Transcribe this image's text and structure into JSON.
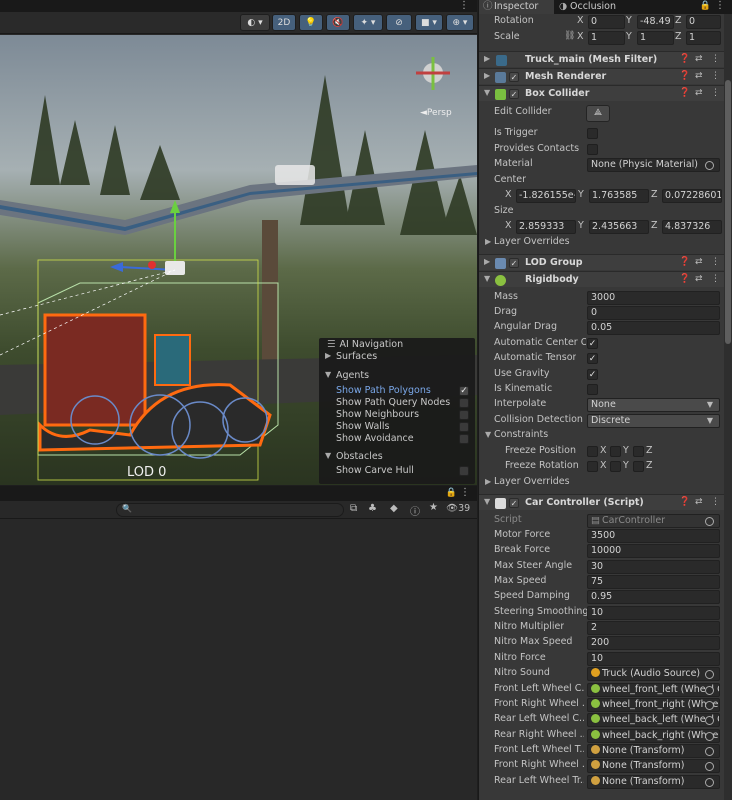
{
  "scene": {
    "toolbar": {
      "mode_2d": "2D"
    },
    "lod_label": "LOD 0",
    "persp_label": "◄Persp",
    "nav": {
      "title": "AI Navigation",
      "surfaces": "Surfaces",
      "agents": "Agents",
      "items": [
        {
          "label": "Show Path Polygons",
          "checked": true
        },
        {
          "label": "Show Path Query Nodes",
          "checked": false
        },
        {
          "label": "Show Neighbours",
          "checked": false
        },
        {
          "label": "Show Walls",
          "checked": false
        },
        {
          "label": "Show Avoidance",
          "checked": false
        }
      ],
      "obstacles": "Obstacles",
      "carve": {
        "label": "Show Carve Hull",
        "checked": false
      }
    }
  },
  "bottom": {
    "count": "39",
    "search_placeholder": ""
  },
  "inspector": {
    "tabs": [
      "Inspector",
      "Occlusion"
    ],
    "rotation": {
      "label": "Rotation",
      "x": "0",
      "y": "-48.49",
      "z": "0"
    },
    "scale": {
      "label": "Scale",
      "x": "1",
      "y": "1",
      "z": "1"
    },
    "mesh_filter": "Truck_main (Mesh Filter)",
    "mesh_renderer": "Mesh Renderer",
    "box_collider": {
      "title": "Box Collider",
      "edit_collider": "Edit Collider",
      "is_trigger": "Is Trigger",
      "provides_contacts": "Provides Contacts",
      "material_label": "Material",
      "material_value": "None (Physic Material)",
      "center_label": "Center",
      "center": {
        "x": "-1.826155e-",
        "y": "1.763585",
        "z": "0.07228601"
      },
      "size_label": "Size",
      "size": {
        "x": "2.859333",
        "y": "2.435663",
        "z": "4.837326"
      },
      "layer_overrides": "Layer Overrides"
    },
    "lod_group": "LOD Group",
    "rigidbody": {
      "title": "Rigidbody",
      "mass_label": "Mass",
      "mass": "3000",
      "drag_label": "Drag",
      "drag": "0",
      "angular_drag_label": "Angular Drag",
      "angular_drag": "0.05",
      "auto_center_label": "Automatic Center Of",
      "auto_tensor_label": "Automatic Tensor",
      "use_gravity_label": "Use Gravity",
      "is_kinematic_label": "Is Kinematic",
      "interpolate_label": "Interpolate",
      "interpolate": "None",
      "collision_label": "Collision Detection",
      "collision": "Discrete",
      "constraints_label": "Constraints",
      "freeze_pos_label": "Freeze Position",
      "freeze_rot_label": "Freeze Rotation",
      "x": "X",
      "y": "Y",
      "z": "Z",
      "layer_overrides": "Layer Overrides"
    },
    "car_controller": {
      "title": "Car Controller (Script)",
      "script_label": "Script",
      "script_value": "CarController",
      "fields": [
        {
          "label": "Motor Force",
          "value": "3500"
        },
        {
          "label": "Break Force",
          "value": "10000"
        },
        {
          "label": "Max Steer Angle",
          "value": "30"
        },
        {
          "label": "Max Speed",
          "value": "75"
        },
        {
          "label": "Speed Damping",
          "value": "0.95"
        },
        {
          "label": "Steering Smoothing",
          "value": "10"
        },
        {
          "label": "Nitro Multiplier",
          "value": "2"
        },
        {
          "label": "Nitro Max Speed",
          "value": "200"
        },
        {
          "label": "Nitro Force",
          "value": "10"
        }
      ],
      "refs": [
        {
          "label": "Nitro Sound",
          "value": "Truck (Audio Source)",
          "icon": "audio-source-icon"
        },
        {
          "label": "Front Left Wheel C...",
          "value": "wheel_front_left (Wheel C",
          "icon": "wheel-collider-icon"
        },
        {
          "label": "Front Right Wheel ...",
          "value": "wheel_front_right (Whee",
          "icon": "wheel-collider-icon"
        },
        {
          "label": "Rear Left Wheel C...",
          "value": "wheel_back_left (Wheel C",
          "icon": "wheel-collider-icon"
        },
        {
          "label": "Rear Right Wheel ...",
          "value": "wheel_back_right (Whee",
          "icon": "wheel-collider-icon"
        },
        {
          "label": "Front Left Wheel T...",
          "value": "None (Transform)",
          "icon": "transform-icon"
        },
        {
          "label": "Front Right Wheel ...",
          "value": "None (Transform)",
          "icon": "transform-icon"
        },
        {
          "label": "Rear Left Wheel Tr...",
          "value": "None (Transform)",
          "icon": "transform-icon"
        }
      ]
    }
  }
}
